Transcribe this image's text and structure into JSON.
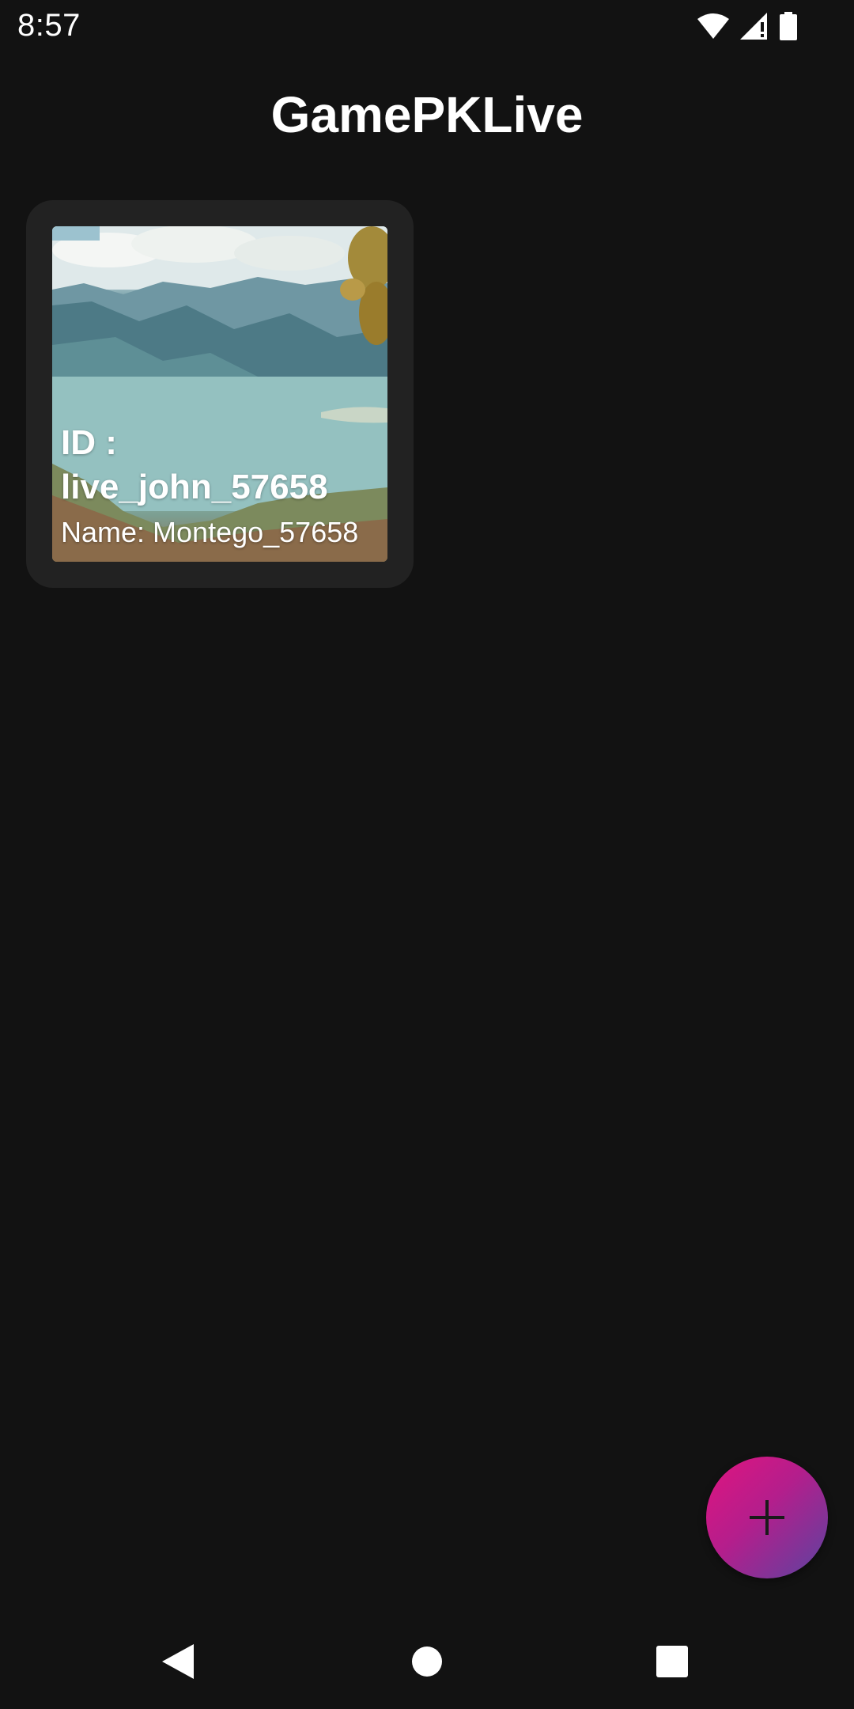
{
  "status_bar": {
    "time": "8:57",
    "icons": [
      "wifi-icon",
      "cell-signal-icon",
      "battery-icon"
    ]
  },
  "app": {
    "title": "GamePKLive"
  },
  "rooms": [
    {
      "id_line1": "ID :",
      "id_line2": "live_john_57658",
      "name": "Name: Montego_57658",
      "thumbnail": "lake-mountain-landscape"
    }
  ],
  "fab": {
    "icon": "plus-icon",
    "colors": [
      "#e0147f",
      "#5a44a0"
    ]
  },
  "nav_bar": {
    "icons": [
      "back-icon",
      "home-icon",
      "recents-icon"
    ]
  },
  "colors": {
    "background": "#121212",
    "card": "#222222",
    "text": "#ffffff"
  }
}
